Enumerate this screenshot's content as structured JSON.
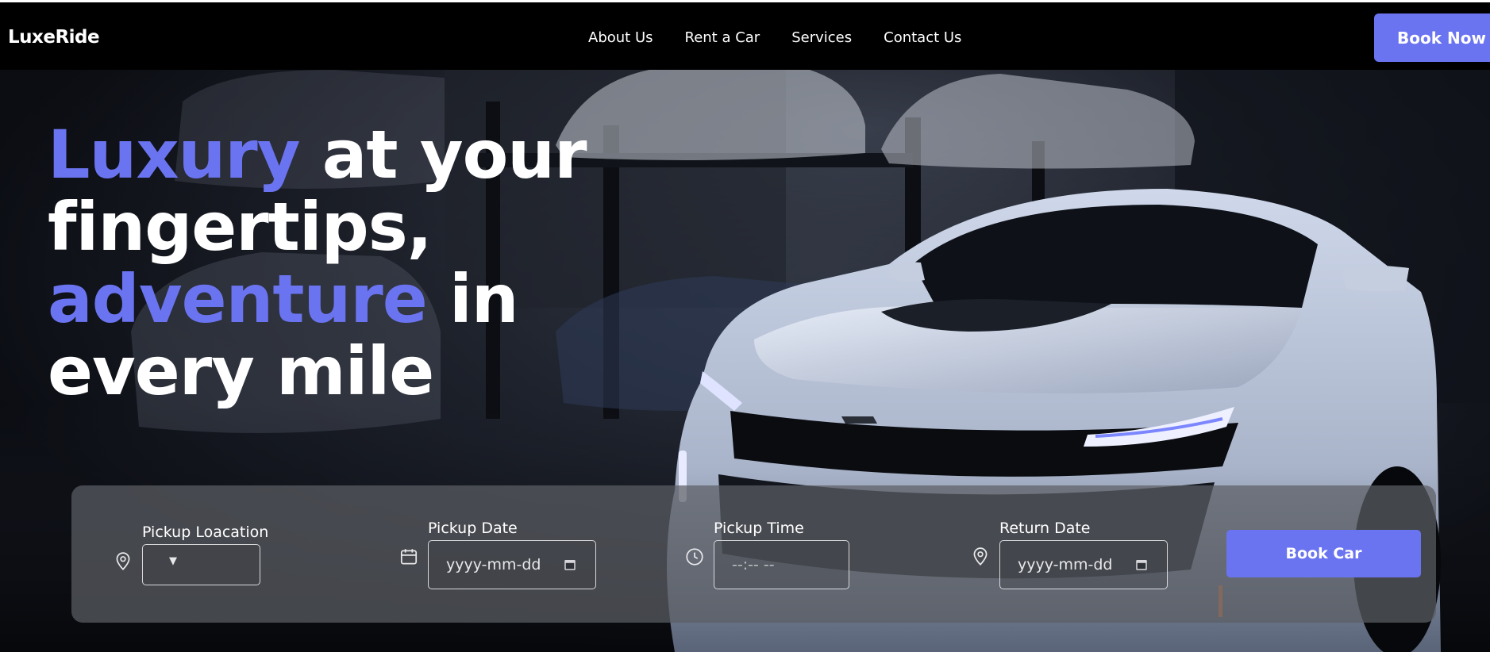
{
  "brand": {
    "name": "LuxeRide",
    "accent_color": "#6b74f0"
  },
  "nav": {
    "links": [
      "About Us",
      "Rent a Car",
      "Services",
      "Contact Us"
    ],
    "cta_label": "Book Now"
  },
  "hero": {
    "headline": {
      "part1": "Luxury",
      "part2": " at your fingertips,",
      "part3": "adventure",
      "part4": " in every mile"
    }
  },
  "booking": {
    "pickup_location": {
      "label": "Pickup Loacation",
      "icon": "map-pin-icon",
      "value": ""
    },
    "pickup_date": {
      "label": "Pickup Date",
      "icon": "calendar-icon",
      "placeholder": "yyyy-mm-dd"
    },
    "pickup_time": {
      "label": "Pickup Time",
      "icon": "clock-icon",
      "placeholder": "--:-- --"
    },
    "return_date": {
      "label": "Return Date",
      "icon": "map-pin-icon",
      "placeholder": "yyyy-mm-dd"
    },
    "submit_label": "Book Car"
  }
}
